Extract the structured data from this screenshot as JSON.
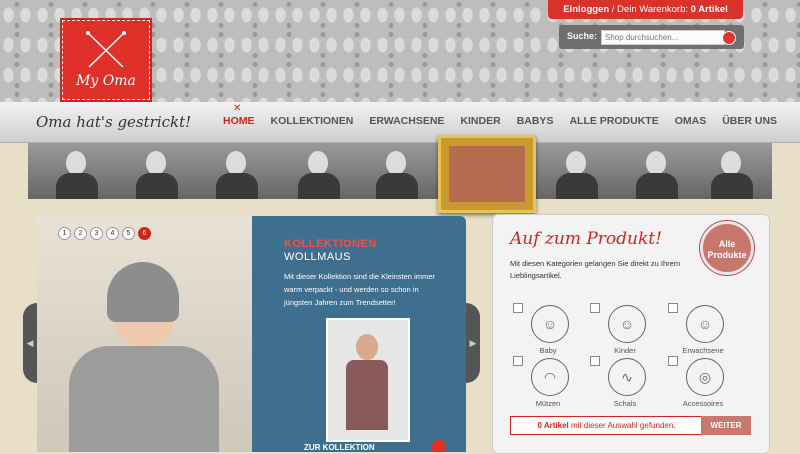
{
  "brand": {
    "logo_text": "My Oma",
    "slogan": "Oma hat's gestrickt!"
  },
  "account": {
    "login": "Einloggen",
    "cart_prefix": "/ Dein Warenkorb:",
    "cart_count": "0 Artikel"
  },
  "search": {
    "label": "Suche:",
    "placeholder": "Shop durchsuchen..."
  },
  "nav": {
    "items": [
      "HOME",
      "KOLLEKTIONEN",
      "ERWACHSENE",
      "KINDER",
      "BABYS",
      "ALLE PRODUKTE",
      "OMAS",
      "ÜBER UNS"
    ]
  },
  "slider": {
    "dots": [
      "1",
      "2",
      "3",
      "4",
      "5",
      "6"
    ],
    "active_dot": "6",
    "title": "KOLLEKTIONEN",
    "subtitle": "WOLLMAUS",
    "description": "Mit dieser Kollektion sind die Kleinsten immer warm verpackt - und werden so schon in jüngsten Jahren zum Trendsetter!",
    "link": "ZUR KOLLEKTION"
  },
  "finder": {
    "title": "Auf zum Produkt!",
    "description": "Mit diesen Kategorien gelangen Sie direkt zu Ihrem Lieblingsartikel.",
    "badge": "Alle Produkte",
    "categories": [
      "Baby",
      "Kinder",
      "Erwachsene",
      "Mützen",
      "Schals",
      "Accessoires"
    ],
    "result_count": "0 Artikel",
    "result_text": "mit dieser Auswahl gefunden.",
    "button": "WEITER"
  },
  "colors": {
    "accent": "#d0251f",
    "slide_panel": "#3f6f8f"
  }
}
